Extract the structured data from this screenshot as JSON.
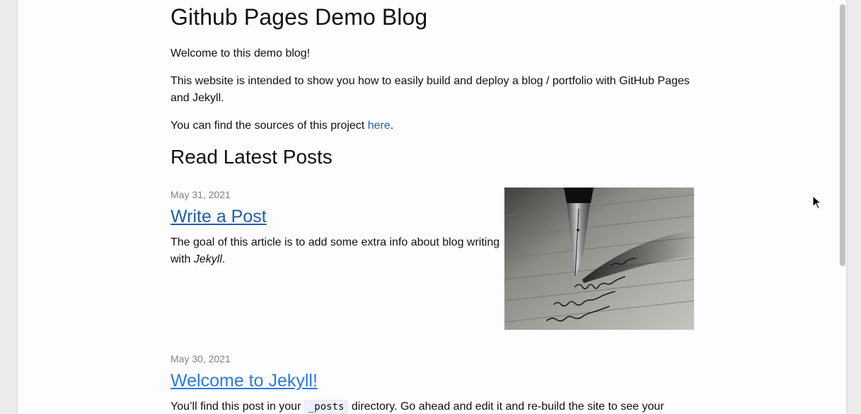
{
  "site": {
    "title": "Github Pages Demo Blog",
    "welcome": "Welcome to this demo blog!",
    "intro": "This website is intended to show you how to easily build and deploy a blog / portfolio with GitHub Pages and Jekyll.",
    "sources_prefix": "You can find the sources of this project ",
    "sources_link": "here",
    "sources_suffix": "."
  },
  "latest": {
    "heading": "Read Latest Posts"
  },
  "posts": [
    {
      "date": "May 31, 2021",
      "title": "Write a Post",
      "excerpt_prefix": "The goal of this article is to add some extra info about blog writing with ",
      "excerpt_em": "Jekyll",
      "excerpt_suffix": ".",
      "image_icon": "fountain-pen-writing-image"
    },
    {
      "date": "May 30, 2021",
      "title": "Welcome to Jekyll!",
      "excerpt_prefix": "You’ll find this post in your ",
      "excerpt_code": "_posts",
      "excerpt_suffix": " directory. Go ahead and edit it and re-build the site to see your"
    }
  ],
  "colors": {
    "link": "#2a7ae2",
    "link_visited": "#1f5fa8",
    "meta": "#828282"
  }
}
